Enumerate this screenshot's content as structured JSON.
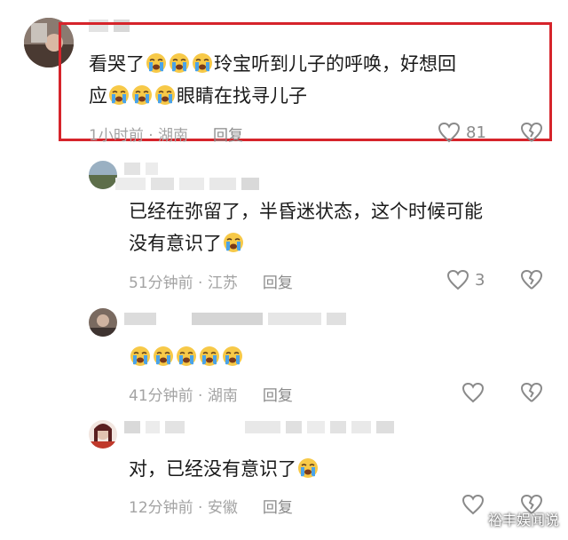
{
  "comments": [
    {
      "text_before": "看哭了",
      "emoji_count_1": 3,
      "text_middle": "玲宝听到儿子的呼唤，好想回",
      "text_line2_start": "应",
      "emoji_count_2": 3,
      "text_line2_end": "眼睛在找寻儿子",
      "time_location": "1小时前 · 湖南",
      "reply_label": "回复",
      "like_count": "81"
    },
    {
      "line1": "已经在弥留了，半昏迷状态，这个时候可能",
      "line2": "没有意识了",
      "emoji_count": 1,
      "time_location": "51分钟前 · 江苏",
      "reply_label": "回复",
      "like_count": "3"
    },
    {
      "emoji_count": 5,
      "time_location": "41分钟前 · 湖南",
      "reply_label": "回复",
      "like_count": ""
    },
    {
      "text": "对，已经没有意识了",
      "emoji_count": 1,
      "time_location": "12分钟前 · 安徽",
      "reply_label": "回复",
      "like_count": ""
    }
  ],
  "watermark": "裕丰娱闻说",
  "colors": {
    "highlight_border": "#d6242b",
    "meta_text": "#a3a3a3",
    "emoji_face": "#f7c948",
    "emoji_tear": "#4aa3e8"
  }
}
